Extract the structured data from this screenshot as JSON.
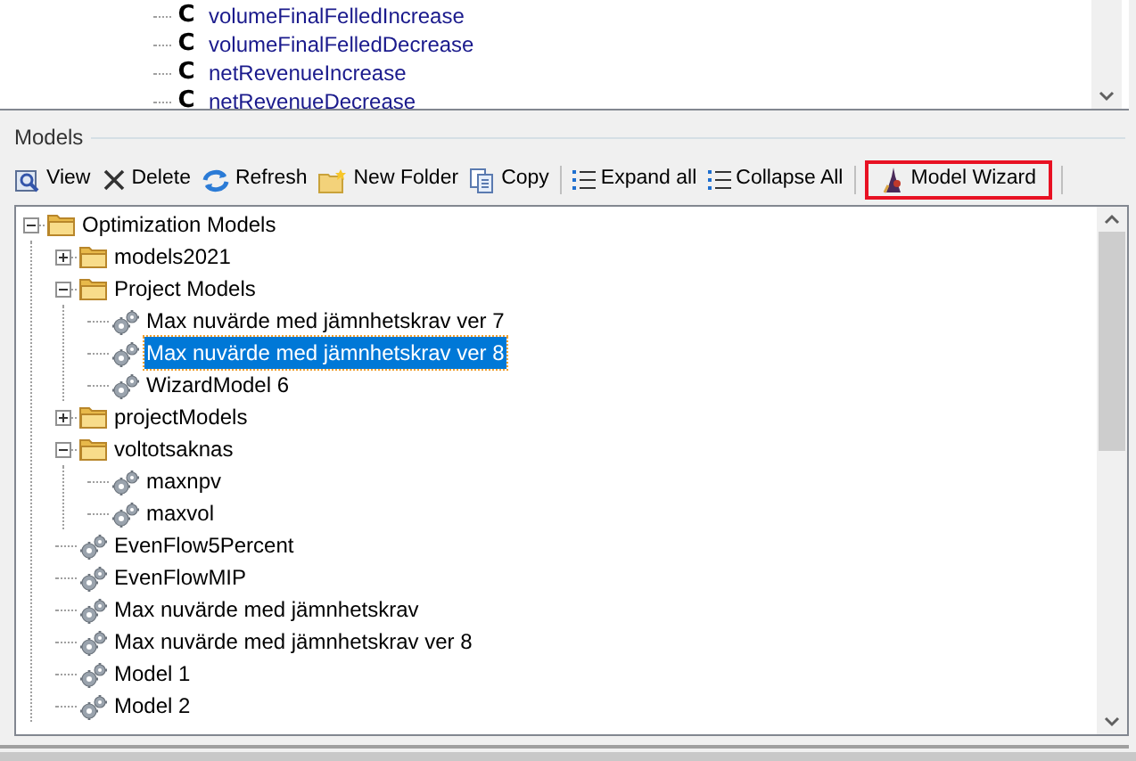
{
  "top_tree": {
    "items": [
      {
        "icon_letter": "C",
        "label": "volumeFinalFelledIncrease"
      },
      {
        "icon_letter": "C",
        "label": "volumeFinalFelledDecrease"
      },
      {
        "icon_letter": "C",
        "label": "netRevenueIncrease"
      },
      {
        "icon_letter": "C",
        "label": "netRevenueDecrease"
      }
    ]
  },
  "models_panel": {
    "title": "Models",
    "toolbar": [
      {
        "kind": "button",
        "label": "View",
        "highlighted": false
      },
      {
        "kind": "button",
        "label": "Delete",
        "highlighted": false
      },
      {
        "kind": "button",
        "label": "Refresh",
        "highlighted": false
      },
      {
        "kind": "button",
        "label": "New Folder",
        "highlighted": false
      },
      {
        "kind": "button",
        "label": "Copy",
        "highlighted": false
      },
      {
        "kind": "separator"
      },
      {
        "kind": "button",
        "label": "Expand all",
        "highlighted": false
      },
      {
        "kind": "button",
        "label": "Collapse All",
        "highlighted": false
      },
      {
        "kind": "separator"
      },
      {
        "kind": "button",
        "label": "Model Wizard",
        "highlighted": true
      },
      {
        "kind": "separator"
      }
    ],
    "tree": [
      {
        "kind": "folder",
        "label": "Optimization Models",
        "expanded": true,
        "selected": false,
        "children": [
          {
            "kind": "folder",
            "label": "models2021",
            "expanded": false,
            "selected": false
          },
          {
            "kind": "folder",
            "label": "Project Models",
            "expanded": true,
            "selected": false,
            "children": [
              {
                "kind": "model",
                "label": "Max nuvärde med jämnhetskrav ver 7",
                "selected": false
              },
              {
                "kind": "model",
                "label": "Max nuvärde med jämnhetskrav ver 8",
                "selected": true
              },
              {
                "kind": "model",
                "label": "WizardModel 6",
                "selected": false
              }
            ]
          },
          {
            "kind": "folder",
            "label": "projectModels",
            "expanded": false,
            "selected": false
          },
          {
            "kind": "folder",
            "label": "voltotsaknas",
            "expanded": true,
            "selected": false,
            "children": [
              {
                "kind": "model",
                "label": "maxnpv",
                "selected": false
              },
              {
                "kind": "model",
                "label": "maxvol",
                "selected": false
              }
            ]
          },
          {
            "kind": "model",
            "label": "EvenFlow5Percent",
            "selected": false
          },
          {
            "kind": "model",
            "label": "EvenFlowMIP",
            "selected": false
          },
          {
            "kind": "model",
            "label": "Max nuvärde med jämnhetskrav",
            "selected": false
          },
          {
            "kind": "model",
            "label": "Max nuvärde med jämnhetskrav ver 8",
            "selected": false
          },
          {
            "kind": "model",
            "label": "Model 1",
            "selected": false
          },
          {
            "kind": "model",
            "label": "Model 2",
            "selected": false
          }
        ]
      }
    ]
  }
}
